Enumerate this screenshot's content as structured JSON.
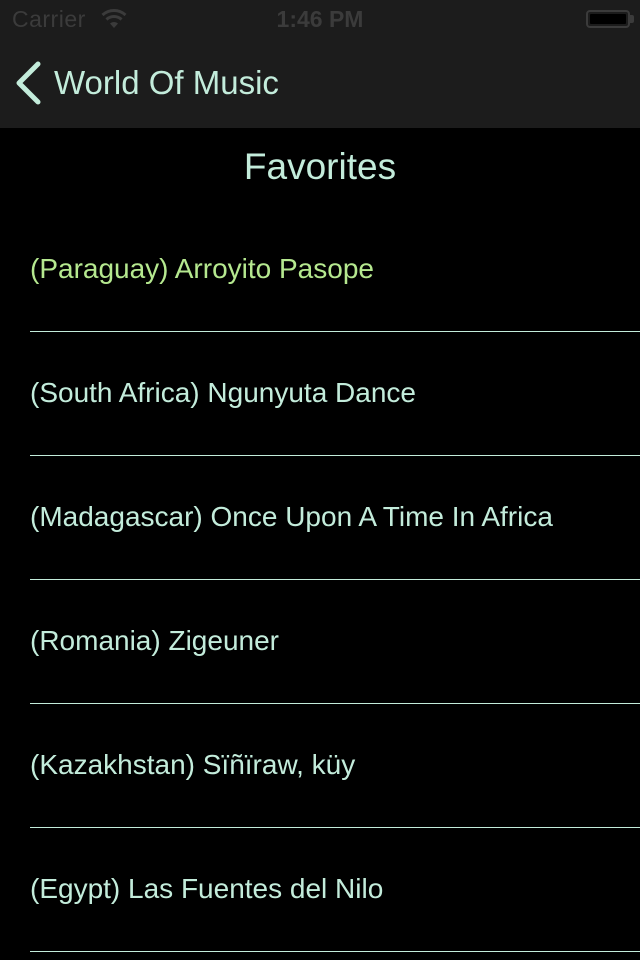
{
  "status_bar": {
    "carrier": "Carrier",
    "time": "1:46 PM",
    "wifi_icon": "wifi-icon",
    "battery_icon": "battery-icon"
  },
  "nav": {
    "back_label": "World Of Music",
    "back_icon": "chevron-left-icon"
  },
  "page": {
    "title": "Favorites"
  },
  "favorites": [
    {
      "label": "(Paraguay) Arroyito Pasope",
      "selected": true
    },
    {
      "label": "(South Africa) Ngunyuta Dance",
      "selected": false
    },
    {
      "label": "(Madagascar) Once Upon A Time In Africa",
      "selected": false
    },
    {
      "label": "(Romania) Zigeuner",
      "selected": false
    },
    {
      "label": "(Kazakhstan) Sïñïraw, küy",
      "selected": false
    },
    {
      "label": "(Egypt) Las Fuentes del Nilo",
      "selected": false
    }
  ],
  "colors": {
    "text": "#c3ecdb",
    "selected_text": "#b5e88f",
    "bar_background": "#1c1c1c",
    "background": "#000000"
  }
}
